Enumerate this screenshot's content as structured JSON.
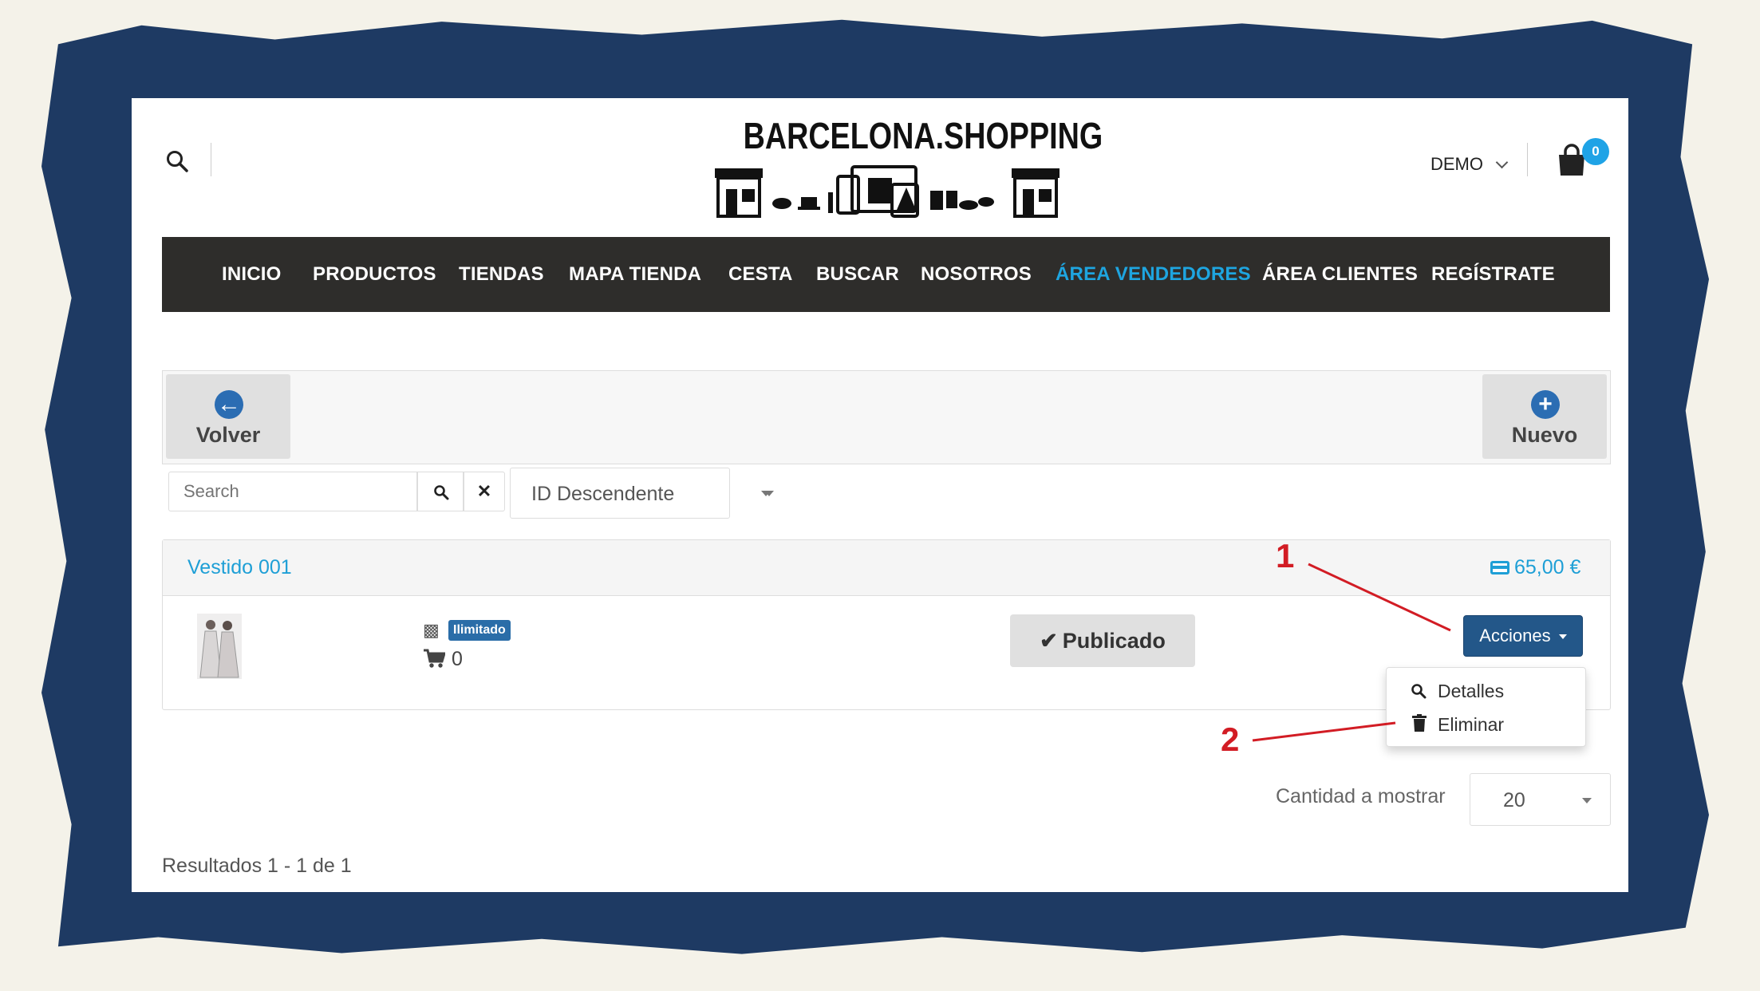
{
  "site": {
    "logo_text": "BARCELONA.SHOPPING"
  },
  "header": {
    "user_menu": "DEMO",
    "cart_count": "0"
  },
  "nav": {
    "items": [
      "INICIO",
      "PRODUCTOS",
      "TIENDAS",
      "MAPA TIENDA",
      "CESTA",
      "BUSCAR",
      "NOSOTROS",
      "ÁREA VENDEDORES",
      "ÁREA CLIENTES",
      "REGÍSTRATE"
    ],
    "active_index": 7
  },
  "toolbar": {
    "back_label": "Volver",
    "new_label": "Nuevo"
  },
  "filters": {
    "search_placeholder": "Search",
    "sort_selected": "ID Descendente"
  },
  "product": {
    "name": "Vestido 001",
    "price": "65,00 €",
    "stock_badge": "Ilimitado",
    "cart_count": "0",
    "status_label": "Publicado",
    "actions_label": "Acciones"
  },
  "actions_menu": {
    "items": [
      "Detalles",
      "Eliminar"
    ]
  },
  "annotations": {
    "one": "1",
    "two": "2"
  },
  "pagination": {
    "per_page_label": "Cantidad a mostrar",
    "per_page_value": "20",
    "results": "Resultados 1 - 1 de 1"
  },
  "colors": {
    "frame": "#1e3a63",
    "accent": "#2a9fd6",
    "navbar": "#2e2d2b",
    "button_primary": "#235789",
    "annotation": "#d21c24"
  }
}
